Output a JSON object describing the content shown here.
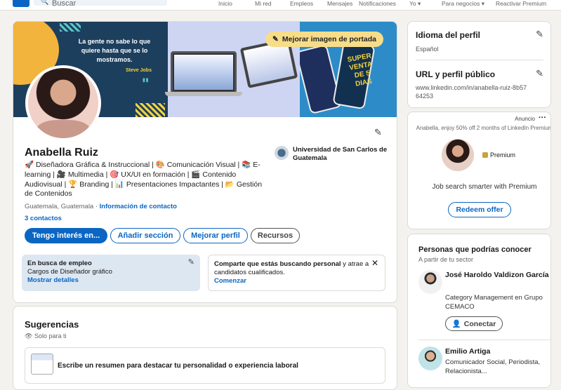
{
  "nav": {
    "search_placeholder": "Buscar",
    "items": [
      "Inicio",
      "Mi red",
      "Empleos",
      "Mensajes",
      "Notificaciones",
      "Yo",
      "Para negocios",
      "Reactivar Premium"
    ]
  },
  "banner": {
    "quote": "La gente no sabe lo que quiere hasta que se lo mostramos.",
    "author": "Steve Jobs",
    "phone_text": "SUPER VENTA DE 5 DIAS",
    "edit_label": "Mejorar imagen de portada"
  },
  "profile": {
    "name": "Anabella Ruiz",
    "headline": "🚀 Diseñadora Gráfica & Instruccional | 🎨 Comunicación Visual | 📚 E-learning | 🎥 Multimedia | 🎯 UX/UI en formación | 🎬 Contenido Audiovisual | 🏆 Branding | 📊 Presentaciones Impactantes | 📂 Gestión de Contenidos",
    "university": "Universidad de San Carlos de Guatemala",
    "location": "Guatemala, Guatemala · ",
    "contact_link": "Información de contacto",
    "contacts": "3 contactos",
    "buttons": [
      "Tengo interés en...",
      "Añadir sección",
      "Mejorar perfil",
      "Recursos"
    ]
  },
  "open_to_work": {
    "title": "En busca de empleo",
    "roles": "Cargos de Diseñador gráfico",
    "link": "Mostrar detalles"
  },
  "share_box": {
    "text_bold": "Comparte que estás buscando personal",
    "text": " y atrae a candidatos cualificados.",
    "link": "Comenzar"
  },
  "suggestions": {
    "title": "Sugerencias",
    "subtitle": "Solo para ti",
    "item": "Escribe un resumen para destacar tu personalidad o experiencia laboral"
  },
  "right": {
    "language_label": "Idioma del perfil",
    "language_value": "Español",
    "url_label": "URL y perfil público",
    "url_value": "www.linkedin.com/in/anabella-ruiz-8b5764253"
  },
  "ad": {
    "label": "Anuncio",
    "text": "Anabella, enjoy 50% off 2 months of LinkedIn Premium",
    "premium": "Premium",
    "tagline": "Job search smarter with Premium",
    "cta": "Redeem offer"
  },
  "people": {
    "title": "Personas que podrías conocer",
    "subtitle": "A partir de tu sector",
    "list": [
      {
        "name": "José Haroldo Valdizon García",
        "desc": "Category Management en Grupo CEMACO",
        "button": "Conectar"
      },
      {
        "name": "Emilio Artiga",
        "desc": "Comunicador Social, Periodista, Relacionista..."
      }
    ]
  },
  "colors": {
    "brand": "#0a66c2",
    "background": "#f4f2ee",
    "banner_edit": "#f7dd8a"
  }
}
